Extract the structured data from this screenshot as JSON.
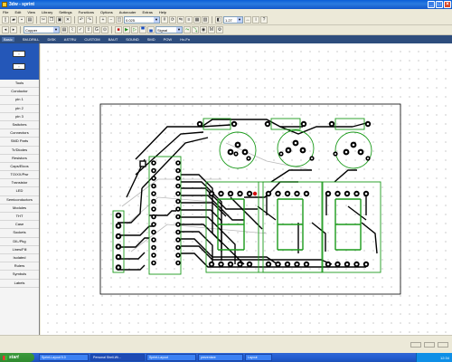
{
  "window": {
    "title": "3dw - sprint"
  },
  "menu": [
    "File",
    "Edit",
    "View",
    "Library",
    "Settings",
    "Functions",
    "Options",
    "Autorouter",
    "Extras",
    "Help"
  ],
  "toolbar": {
    "zoom_value": "0.025",
    "grid_value": "1.27",
    "layer_value": "Copper",
    "net_value": "Signal"
  },
  "tabs": [
    "Basic",
    "SM-DRILL",
    "DISK",
    "ASTRU",
    "CUSTOM",
    "BAUT",
    "SOUND",
    "SMD",
    "POW",
    "Hx-Fn"
  ],
  "left_panel": {
    "items": [
      "Tools",
      "Conductor",
      "pin 1",
      "pin 2",
      "pin 3",
      "Switches",
      "Connectors",
      "SMD Parts",
      "Tr/Diodes",
      "Resistors",
      "Caps/Elcos",
      "TO/XX/Pwr",
      "Transistor",
      "LED",
      "Semiconductors",
      "Modules",
      "THT",
      "Case",
      "Sockets",
      "DIL/Pkg",
      "Lines/Fill",
      "Isolated",
      "Rulers",
      "Symbols",
      "Labels"
    ]
  },
  "taskbar": {
    "start_label": "start",
    "tasks": [
      "Sprint-Layout 5.0",
      "Personal Shell-Wi...",
      "Sprint-Layout",
      "prezentare",
      "Layout"
    ],
    "clock": "12:34"
  },
  "pcb": {
    "board_outline_color": "#000000",
    "trace_color": "#000000",
    "pad_color": "#000000",
    "silk_color": "#1a9a1a",
    "keepout_color": "#b9b9b9",
    "accent_red": "#d01010"
  }
}
